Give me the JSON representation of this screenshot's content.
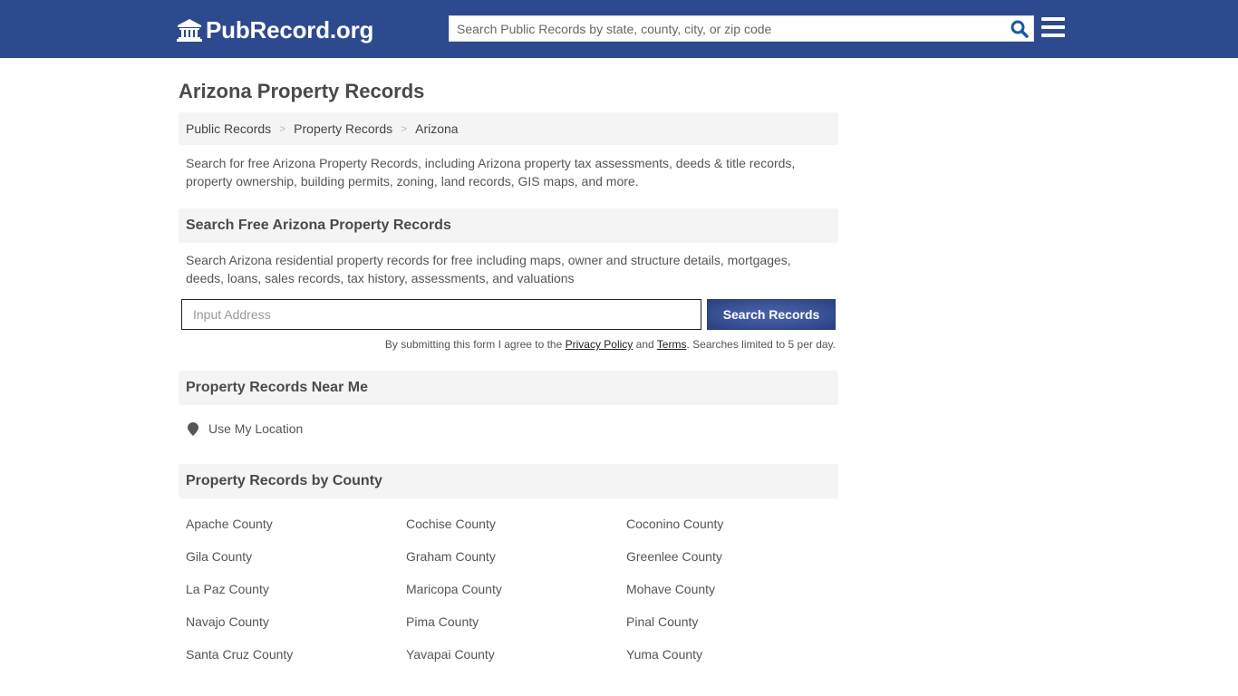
{
  "header": {
    "logo_text": "PubRecord.org",
    "logo_icon": "bank-building-icon",
    "search_placeholder": "Search Public Records by state, county, city, or zip code",
    "search_icon": "search-icon",
    "menu_icon": "hamburger-menu-icon",
    "colors": {
      "bar": "#2e4a8f",
      "search_icon": "#1a5aa8"
    }
  },
  "page": {
    "title": "Arizona Property Records",
    "breadcrumb": [
      {
        "label": "Public Records"
      },
      {
        "label": "Property Records"
      },
      {
        "label": "Arizona"
      }
    ],
    "breadcrumb_separator": ">",
    "intro": "Search for free Arizona Property Records, including Arizona property tax assessments, deeds & title records, property ownership, building permits, zoning, land records, GIS maps, and more."
  },
  "search_section": {
    "heading": "Search Free Arizona Property Records",
    "description": "Search Arizona residential property records for free including maps, owner and structure details, mortgages, deeds, loans, sales records, tax history, assessments, and valuations",
    "address_placeholder": "Input Address",
    "button_label": "Search Records",
    "disclaimer_prefix": "By submitting this form I agree to the ",
    "privacy_link": "Privacy Policy",
    "disclaimer_and": " and ",
    "terms_link": "Terms",
    "disclaimer_suffix": ". Searches limited to 5 per day.",
    "button_color": "#3b5297"
  },
  "near_me": {
    "heading": "Property Records Near Me",
    "location_label": "Use My Location",
    "location_icon": "map-pin-icon"
  },
  "by_county": {
    "heading": "Property Records by County",
    "counties": [
      "Apache County",
      "Cochise County",
      "Coconino County",
      "Gila County",
      "Graham County",
      "Greenlee County",
      "La Paz County",
      "Maricopa County",
      "Mohave County",
      "Navajo County",
      "Pima County",
      "Pinal County",
      "Santa Cruz County",
      "Yavapai County",
      "Yuma County"
    ]
  }
}
